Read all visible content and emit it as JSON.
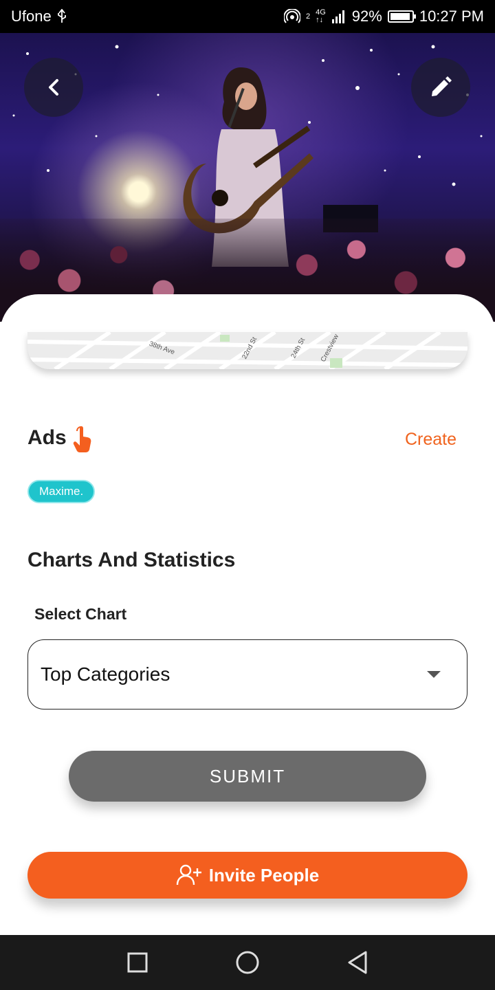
{
  "status_bar": {
    "carrier": "Ufone",
    "signal_top": "2",
    "network_type": "4G",
    "network_sub": "↑↓",
    "battery_percent": "92%",
    "battery_level": 0.92,
    "time": "10:27 PM"
  },
  "hero": {
    "back_icon": "chevron-left-icon",
    "edit_icon": "pencil-icon"
  },
  "map": {
    "labels": [
      "38th Ave",
      "22nd St",
      "24th St",
      "Crestview"
    ]
  },
  "ads": {
    "title": "Ads",
    "icon": "hand-pointer-icon",
    "create_label": "Create",
    "tags": [
      "Maxime."
    ]
  },
  "charts": {
    "title": "Charts And Statistics",
    "select_label": "Select Chart",
    "selected_value": "Top Categories"
  },
  "actions": {
    "submit_label": "SUBMIT",
    "invite_label": "Invite People",
    "invite_icon": "user-plus-icon"
  },
  "colors": {
    "accent": "#f45f1f",
    "tag": "#1fc4cc",
    "submit": "#6b6b6b"
  },
  "nav_bar": {
    "icons": [
      "recents-square-icon",
      "home-circle-icon",
      "back-triangle-icon"
    ]
  }
}
